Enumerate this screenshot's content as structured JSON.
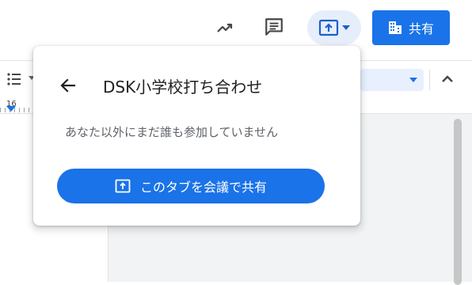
{
  "toolbar": {
    "activity_icon": "trending-up-icon",
    "comments_icon": "comment-icon",
    "present_icon": "present-to-all-icon",
    "share_icon": "domain-icon",
    "share_label": "共有",
    "accent_color": "#1a73e8"
  },
  "editor": {
    "ruler_number": "16"
  },
  "popover": {
    "title": "DSK小学校打ち合わせ",
    "message": "あなた以外にまだ誰も参加していません",
    "share_tab_label": "このタブを会議で共有",
    "back_icon": "arrow-back-icon",
    "share_tab_icon": "present-to-all-icon"
  }
}
